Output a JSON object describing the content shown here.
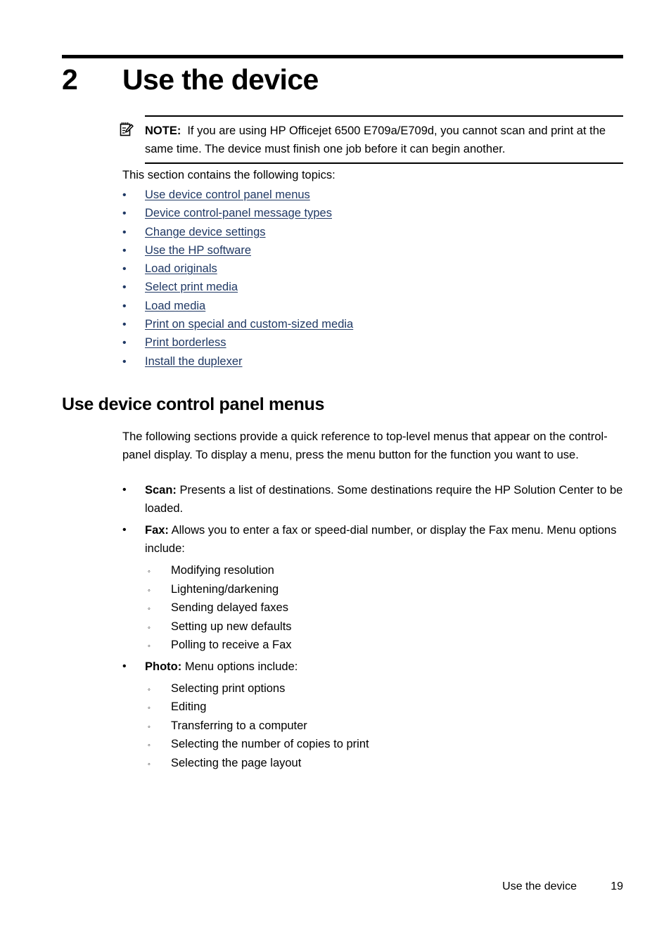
{
  "chapter": {
    "number": "2",
    "title": "Use the device"
  },
  "note": {
    "icon": "note-pencil-icon",
    "label": "NOTE:",
    "text": "If you are using HP Officejet 6500 E709a/E709d, you cannot scan and print at the same time. The device must finish one job before it can begin another."
  },
  "intro": {
    "text": "This section contains the following topics:"
  },
  "topics": {
    "bullet": "•",
    "link_color": "#1f3864",
    "items": [
      {
        "label": "Use device control panel menus"
      },
      {
        "label": "Device control-panel message types"
      },
      {
        "label": "Change device settings"
      },
      {
        "label": "Use the HP software"
      },
      {
        "label": "Load originals"
      },
      {
        "label": "Select print media"
      },
      {
        "label": "Load media"
      },
      {
        "label": "Print on special and custom-sized media"
      },
      {
        "label": "Print borderless"
      },
      {
        "label": "Install the duplexer"
      }
    ]
  },
  "section": {
    "heading": "Use device control panel menus",
    "paragraph": "The following sections provide a quick reference to top-level menus that appear on the control-panel display. To display a menu, press the menu button for the function you want to use."
  },
  "menus": {
    "bullet": "•",
    "sub_bullet": "◦",
    "items": [
      {
        "term": "Scan:",
        "description": " Presents a list of destinations. Some destinations require the HP Solution Center to be loaded.",
        "sub": []
      },
      {
        "term": "Fax:",
        "description": " Allows you to enter a fax or speed-dial number, or display the Fax menu. Menu options include:",
        "sub": [
          "Modifying resolution",
          "Lightening/darkening",
          "Sending delayed faxes",
          "Setting up new defaults",
          "Polling to receive a Fax"
        ]
      },
      {
        "term": "Photo:",
        "description": " Menu options include:",
        "sub": [
          "Selecting print options",
          "Editing",
          "Transferring to a computer",
          "Selecting the number of copies to print",
          "Selecting the page layout"
        ]
      }
    ]
  },
  "footer": {
    "title": "Use the device",
    "page": "19"
  }
}
